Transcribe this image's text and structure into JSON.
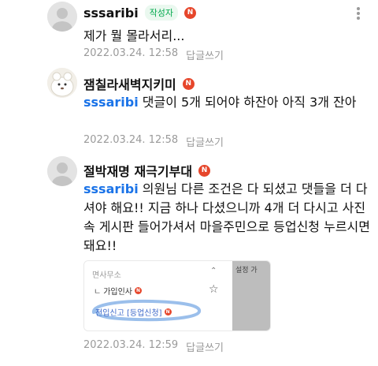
{
  "comments": [
    {
      "author": "sssaribi",
      "writer_badge": "작성자",
      "n_badge": "N",
      "text": "제가 뭘 몰라서리...",
      "date": "2022.03.24. 12:58",
      "reply": "답글쓰기"
    },
    {
      "author": "잼칠라새벽지키미",
      "n_badge": "N",
      "mention": "sssaribi",
      "text": "댓글이 5개 되어야 하잔아 아직 3개 잔아",
      "date": "2022.03.24. 12:58",
      "reply": "답글쓰기"
    },
    {
      "author": "절박재명 재극기부대",
      "n_badge": "N",
      "mention": "sssaribi",
      "text": "의원님 다른 조건은 다 되셨고 댓들을 더 다셔야 해요!! 지금 하나 다셨으니까 4개 더 다시고 사진 속 게시판 들어가셔서 마을주민으로 등업신청 누르시면 돼요!!",
      "date": "2022.03.24. 12:59",
      "reply": "답글쓰기",
      "attachment": {
        "menu_title": "면사무소",
        "item1": "가입인사",
        "item2": "전입신고 [등업신청]",
        "peek_text": "설정 가",
        "chevron": "⌃",
        "star": "☆",
        "branch": "ㄴ"
      }
    }
  ],
  "icons": {
    "more": "more-vertical-icon",
    "star": "star-outline-icon"
  },
  "colors": {
    "mention": "#1a73e8",
    "writer_badge_text": "#03a94d",
    "n_badge": "#e6462b",
    "meta": "#9a9a9a",
    "highlight_circle": "#8ab4e8"
  }
}
